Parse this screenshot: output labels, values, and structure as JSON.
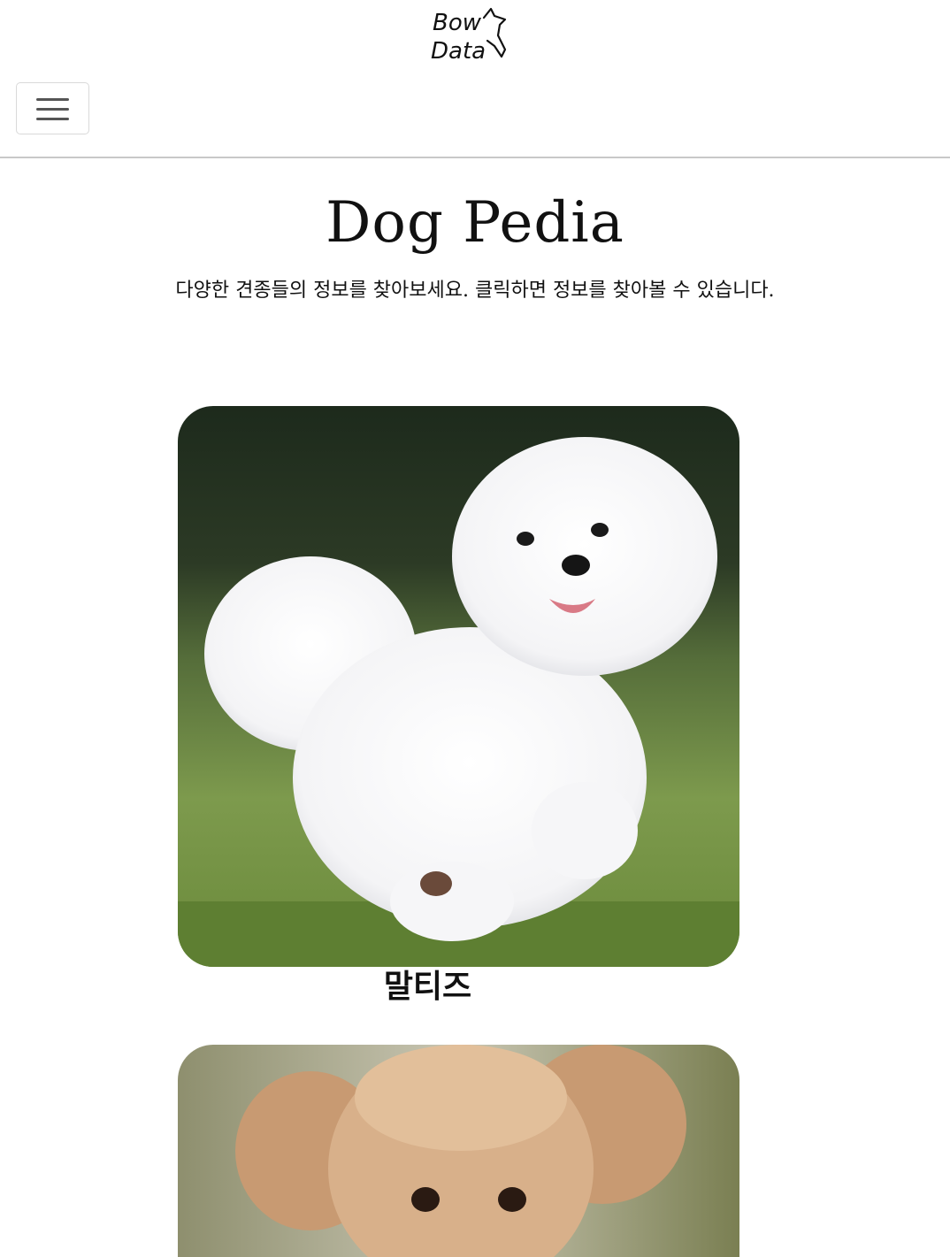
{
  "header": {
    "logo": {
      "line1": "Bow",
      "line2": "Data",
      "icon": "dog-silhouette-icon"
    },
    "menu_icon": "hamburger-menu-icon"
  },
  "main": {
    "title": "Dog Pedia",
    "subtitle": "다양한 견종들의 정보를 찾아보세요. 클릭하면 정보를 찾아볼 수 있습니다."
  },
  "breeds": [
    {
      "name": "말티즈",
      "photo": "white-maltese-running-on-grass"
    },
    {
      "name": "",
      "photo": "brown-poodle-with-flying-ears"
    }
  ],
  "colors": {
    "text": "#111111",
    "divider": "#c8c8c8",
    "toggle_border": "#d9d9d9",
    "toggle_bar": "#555555"
  }
}
